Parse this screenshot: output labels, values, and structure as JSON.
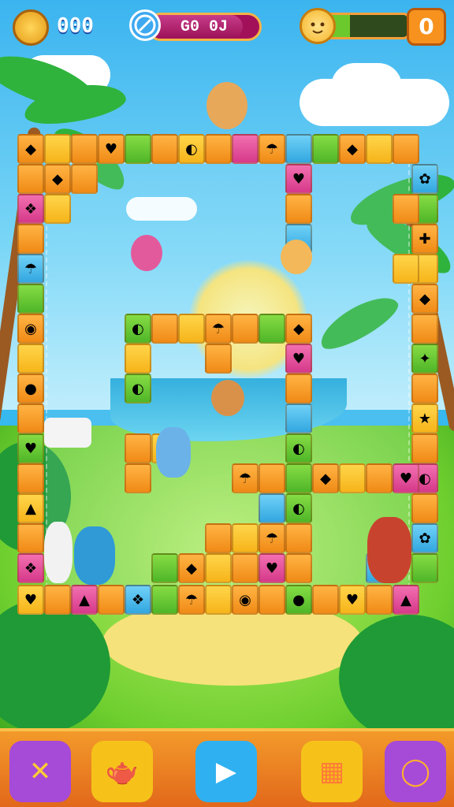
{
  "hud": {
    "coins_value": "000",
    "progress_text": "G0 0J",
    "progress_fill_fraction": 0.85,
    "pet_fill_fraction": 0.3,
    "pet_count": "0"
  },
  "icons": {
    "coin": "coin-icon",
    "timer": "timer-icon",
    "pet": "pet-icon"
  },
  "bottom_buttons": [
    {
      "name": "close-button",
      "icon": "x-icon",
      "glyph": "✕",
      "bg": "#a64ad8",
      "inner": "#ffcc33"
    },
    {
      "name": "watering-can-button",
      "icon": "watering-can-icon",
      "glyph": "🫖",
      "bg": "#f6c21a",
      "inner": "#e23b3b"
    },
    {
      "name": "play-button",
      "icon": "play-icon",
      "glyph": "▶",
      "bg": "#2fb0f0",
      "inner": "#ffffff"
    },
    {
      "name": "inventory-button",
      "icon": "grid-icon",
      "glyph": "▦",
      "bg": "#f6c21a",
      "inner": "#ff7a38"
    },
    {
      "name": "chat-button",
      "icon": "speech-bubble-icon",
      "glyph": "◯",
      "bg": "#a64ad8",
      "inner": "#ffb02e"
    }
  ],
  "colors": {
    "accent_orange": "#f08a16",
    "accent_green": "#4fb628",
    "accent_pink": "#d6398a",
    "accent_purple": "#a64ad8"
  }
}
